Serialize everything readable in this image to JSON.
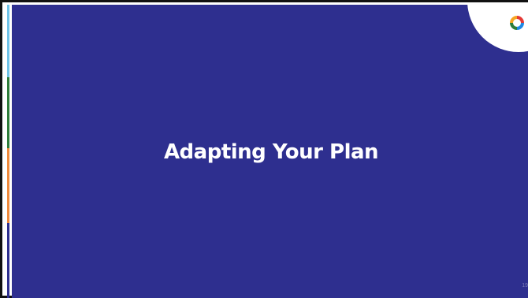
{
  "slide": {
    "title": "Adapting Your Plan",
    "page_number": "19"
  },
  "colors": {
    "background": "#2e2f8f",
    "title_text": "#ffffff",
    "stripes": [
      "#6fc3e8",
      "#2e7d3a",
      "#f08a3c",
      "#2e2f8f"
    ],
    "logo": [
      "#f5a623",
      "#2e7d3a",
      "#1e88e5",
      "#e53935"
    ]
  },
  "icons": {
    "logo": "brand-logo-icon"
  }
}
